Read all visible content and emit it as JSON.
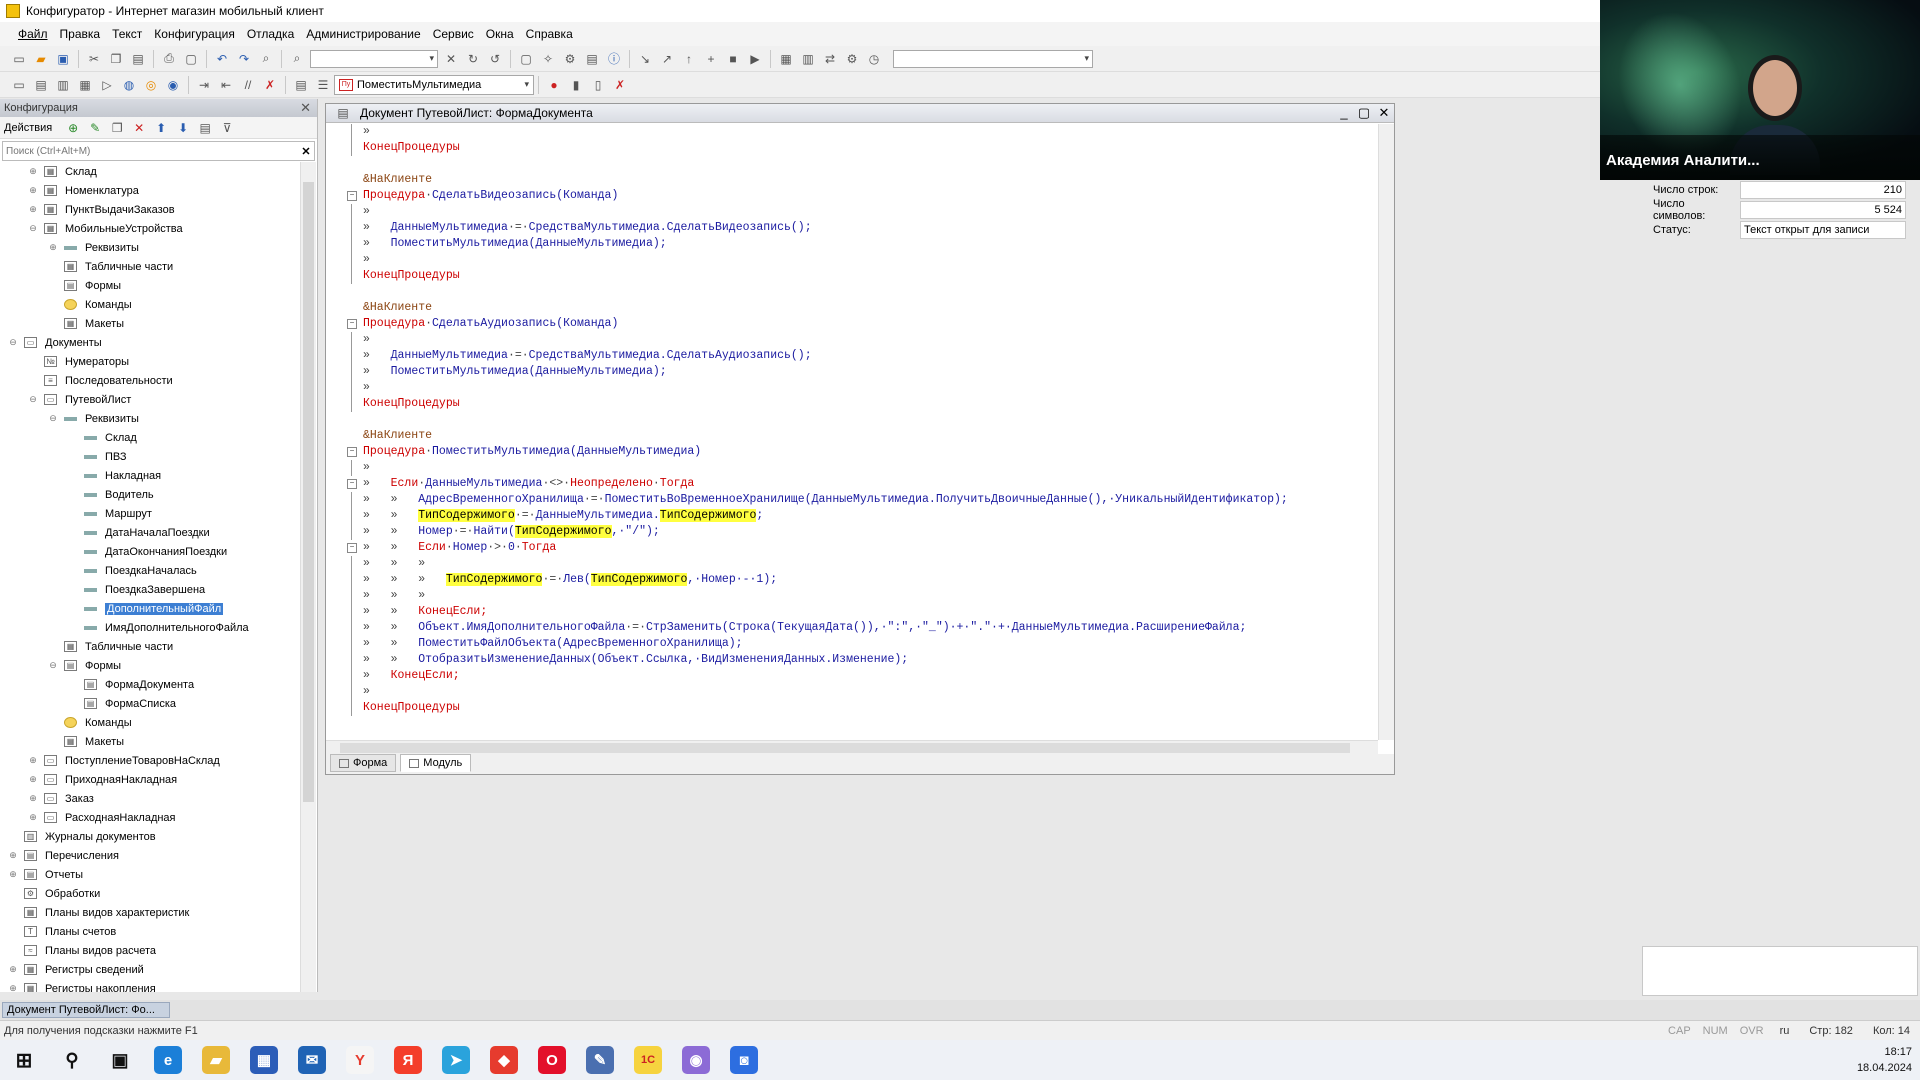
{
  "window": {
    "title": "Конфигуратор - Интернет магазин мобильный клиент"
  },
  "menu": [
    "Файл",
    "Правка",
    "Текст",
    "Конфигурация",
    "Отладка",
    "Администрирование",
    "Сервис",
    "Окна",
    "Справка"
  ],
  "toolbar2": {
    "procedure_select": "ПоместитьМультимедиа",
    "procedure_icon": "Пу"
  },
  "config_panel": {
    "title": "Конфигурация",
    "actions_label": "Действия",
    "search_placeholder": "Поиск (Ctrl+Alt+M)",
    "tree": [
      {
        "label": "Склад",
        "level": 1,
        "exp": "+",
        "icon": "table"
      },
      {
        "label": "Номенклатура",
        "level": 1,
        "exp": "+",
        "icon": "table"
      },
      {
        "label": "ПунктВыдачиЗаказов",
        "level": 1,
        "exp": "+",
        "icon": "table"
      },
      {
        "label": "МобильныеУстройства",
        "level": 1,
        "exp": "−",
        "icon": "table"
      },
      {
        "label": "Реквизиты",
        "level": 2,
        "exp": "+",
        "icon": "attr"
      },
      {
        "label": "Табличные части",
        "level": 2,
        "exp": "",
        "icon": "table"
      },
      {
        "label": "Формы",
        "level": 2,
        "exp": "",
        "icon": "form"
      },
      {
        "label": "Команды",
        "level": 2,
        "exp": "",
        "icon": "cmd"
      },
      {
        "label": "Макеты",
        "level": 2,
        "exp": "",
        "icon": "table"
      },
      {
        "label": "Документы",
        "level": 0,
        "exp": "−",
        "icon": "doc"
      },
      {
        "label": "Нумераторы",
        "level": 1,
        "exp": "",
        "icon": "num"
      },
      {
        "label": "Последовательности",
        "level": 1,
        "exp": "",
        "icon": "seq"
      },
      {
        "label": "ПутевойЛист",
        "level": 1,
        "exp": "−",
        "icon": "doc"
      },
      {
        "label": "Реквизиты",
        "level": 2,
        "exp": "−",
        "icon": "attr"
      },
      {
        "label": "Склад",
        "level": 3,
        "exp": "",
        "icon": "attr"
      },
      {
        "label": "ПВЗ",
        "level": 3,
        "exp": "",
        "icon": "attr"
      },
      {
        "label": "Накладная",
        "level": 3,
        "exp": "",
        "icon": "attr"
      },
      {
        "label": "Водитель",
        "level": 3,
        "exp": "",
        "icon": "attr"
      },
      {
        "label": "Маршрут",
        "level": 3,
        "exp": "",
        "icon": "attr"
      },
      {
        "label": "ДатаНачалаПоездки",
        "level": 3,
        "exp": "",
        "icon": "attr"
      },
      {
        "label": "ДатаОкончанияПоездки",
        "level": 3,
        "exp": "",
        "icon": "attr"
      },
      {
        "label": "ПоездкаНачалась",
        "level": 3,
        "exp": "",
        "icon": "attr"
      },
      {
        "label": "ПоездкаЗавершена",
        "level": 3,
        "exp": "",
        "icon": "attr"
      },
      {
        "label": "ДополнительныйФайл",
        "level": 3,
        "exp": "",
        "icon": "attr",
        "selected": true
      },
      {
        "label": "ИмяДополнительногоФайла",
        "level": 3,
        "exp": "",
        "icon": "attr"
      },
      {
        "label": "Табличные части",
        "level": 2,
        "exp": "",
        "icon": "table"
      },
      {
        "label": "Формы",
        "level": 2,
        "exp": "−",
        "icon": "form"
      },
      {
        "label": "ФормаДокумента",
        "level": 3,
        "exp": "",
        "icon": "form"
      },
      {
        "label": "ФормаСписка",
        "level": 3,
        "exp": "",
        "icon": "form"
      },
      {
        "label": "Команды",
        "level": 2,
        "exp": "",
        "icon": "cmd"
      },
      {
        "label": "Макеты",
        "level": 2,
        "exp": "",
        "icon": "table"
      },
      {
        "label": "ПоступлениеТоваровНаСклад",
        "level": 1,
        "exp": "+",
        "icon": "doc"
      },
      {
        "label": "ПриходнаяНакладная",
        "level": 1,
        "exp": "+",
        "icon": "doc"
      },
      {
        "label": "Заказ",
        "level": 1,
        "exp": "+",
        "icon": "doc"
      },
      {
        "label": "РасходнаяНакладная",
        "level": 1,
        "exp": "+",
        "icon": "doc"
      },
      {
        "label": "Журналы документов",
        "level": 0,
        "exp": "",
        "icon": "journal"
      },
      {
        "label": "Перечисления",
        "level": 0,
        "exp": "+",
        "icon": "enum"
      },
      {
        "label": "Отчеты",
        "level": 0,
        "exp": "+",
        "icon": "report"
      },
      {
        "label": "Обработки",
        "level": 0,
        "exp": "",
        "icon": "proc"
      },
      {
        "label": "Планы видов характеристик",
        "level": 0,
        "exp": "",
        "icon": "table"
      },
      {
        "label": "Планы счетов",
        "level": 0,
        "exp": "",
        "icon": "acc"
      },
      {
        "label": "Планы видов расчета",
        "level": 0,
        "exp": "",
        "icon": "calc"
      },
      {
        "label": "Регистры сведений",
        "level": 0,
        "exp": "+",
        "icon": "table"
      },
      {
        "label": "Регистры накопления",
        "level": 0,
        "exp": "+",
        "icon": "table"
      }
    ]
  },
  "document_window": {
    "title": "Документ ПутевойЛист: ФормаДокумента",
    "tabs": [
      "Форма",
      "Модуль"
    ],
    "code": [
      {
        "g": "v",
        "t": [
          [
            "arr",
            "»"
          ]
        ]
      },
      {
        "g": "v",
        "t": [
          [
            "kw",
            "КонецПроцедуры"
          ]
        ]
      },
      {
        "g": "",
        "t": [
          [
            "arr",
            ""
          ]
        ]
      },
      {
        "g": "",
        "t": [
          [
            "dir",
            "&НаКлиенте"
          ]
        ]
      },
      {
        "g": "f",
        "t": [
          [
            "kw",
            "Процедура"
          ],
          [
            "arr",
            "·"
          ],
          [
            "id",
            "СделатьВидеозапись(Команда)"
          ]
        ]
      },
      {
        "g": "v",
        "t": [
          [
            "arr",
            "»"
          ]
        ]
      },
      {
        "g": "v",
        "t": [
          [
            "arr",
            "»   "
          ],
          [
            "id",
            "ДанныеМультимедиа"
          ],
          [
            "arr",
            "·=·"
          ],
          [
            "id",
            "СредстваМультимедиа.СделатьВидеозапись();"
          ]
        ]
      },
      {
        "g": "v",
        "t": [
          [
            "arr",
            "»   "
          ],
          [
            "id",
            "ПоместитьМультимедиа(ДанныеМультимедиа);"
          ]
        ]
      },
      {
        "g": "v",
        "t": [
          [
            "arr",
            "»"
          ]
        ]
      },
      {
        "g": "v",
        "t": [
          [
            "kw",
            "КонецПроцедуры"
          ]
        ]
      },
      {
        "g": "",
        "t": [
          [
            "arr",
            ""
          ]
        ]
      },
      {
        "g": "",
        "t": [
          [
            "dir",
            "&НаКлиенте"
          ]
        ]
      },
      {
        "g": "f",
        "t": [
          [
            "kw",
            "Процедура"
          ],
          [
            "arr",
            "·"
          ],
          [
            "id",
            "СделатьАудиозапись(Команда)"
          ]
        ]
      },
      {
        "g": "v",
        "t": [
          [
            "arr",
            "»"
          ]
        ]
      },
      {
        "g": "v",
        "t": [
          [
            "arr",
            "»   "
          ],
          [
            "id",
            "ДанныеМультимедиа"
          ],
          [
            "arr",
            "·=·"
          ],
          [
            "id",
            "СредстваМультимедиа.СделатьАудиозапись();"
          ]
        ]
      },
      {
        "g": "v",
        "t": [
          [
            "arr",
            "»   "
          ],
          [
            "id",
            "ПоместитьМультимедиа(ДанныеМультимедиа);"
          ]
        ]
      },
      {
        "g": "v",
        "t": [
          [
            "arr",
            "»"
          ]
        ]
      },
      {
        "g": "v",
        "t": [
          [
            "kw",
            "КонецПроцедуры"
          ]
        ]
      },
      {
        "g": "",
        "t": [
          [
            "arr",
            ""
          ]
        ]
      },
      {
        "g": "",
        "t": [
          [
            "dir",
            "&НаКлиенте"
          ]
        ]
      },
      {
        "g": "f",
        "t": [
          [
            "kw",
            "Процедура"
          ],
          [
            "arr",
            "·"
          ],
          [
            "id",
            "ПоместитьМультимедиа(ДанныеМультимедиа)"
          ]
        ]
      },
      {
        "g": "v",
        "t": [
          [
            "arr",
            "»"
          ]
        ]
      },
      {
        "g": "f",
        "t": [
          [
            "arr",
            "»   "
          ],
          [
            "kw",
            "Если"
          ],
          [
            "arr",
            "·"
          ],
          [
            "id",
            "ДанныеМультимедиа"
          ],
          [
            "arr",
            "·<>·"
          ],
          [
            "kw",
            "Неопределено"
          ],
          [
            "arr",
            "·"
          ],
          [
            "kw",
            "Тогда"
          ]
        ]
      },
      {
        "g": "v",
        "t": [
          [
            "arr",
            "»   »   "
          ],
          [
            "id",
            "АдресВременногоХранилища"
          ],
          [
            "arr",
            "·=·"
          ],
          [
            "id",
            "ПоместитьВоВременноеХранилище(ДанныеМультимедиа.ПолучитьДвоичныеДанные(),·УникальныйИдентификатор);"
          ]
        ]
      },
      {
        "g": "v",
        "t": [
          [
            "arr",
            "»   »   "
          ],
          [
            "hl",
            "ТипСодержимого"
          ],
          [
            "arr",
            "·=·"
          ],
          [
            "id",
            "ДанныеМультимедиа."
          ],
          [
            "hl",
            "ТипСодержимого"
          ],
          [
            "id",
            ";"
          ]
        ]
      },
      {
        "g": "v",
        "t": [
          [
            "arr",
            "»   »   "
          ],
          [
            "id",
            "Номер"
          ],
          [
            "arr",
            "·=·"
          ],
          [
            "id",
            "Найти("
          ],
          [
            "hl",
            "ТипСодержимого"
          ],
          [
            "id",
            ",·\"/\");"
          ]
        ]
      },
      {
        "g": "f",
        "t": [
          [
            "arr",
            "»   »   "
          ],
          [
            "kw",
            "Если"
          ],
          [
            "arr",
            "·"
          ],
          [
            "id",
            "Номер"
          ],
          [
            "arr",
            "·>·"
          ],
          [
            "id",
            "0"
          ],
          [
            "arr",
            "·"
          ],
          [
            "kw",
            "Тогда"
          ]
        ]
      },
      {
        "g": "v",
        "t": [
          [
            "arr",
            "»   »   »"
          ]
        ]
      },
      {
        "g": "v",
        "t": [
          [
            "arr",
            "»   »   »   "
          ],
          [
            "hl",
            "ТипСодержимого"
          ],
          [
            "arr",
            "·=·"
          ],
          [
            "id",
            "Лев("
          ],
          [
            "hl",
            "ТипСодержимого"
          ],
          [
            "id",
            ",·Номер·-·1);"
          ]
        ]
      },
      {
        "g": "v",
        "t": [
          [
            "arr",
            "»   »   »"
          ]
        ]
      },
      {
        "g": "v",
        "t": [
          [
            "arr",
            "»   »   "
          ],
          [
            "kw",
            "КонецЕсли;"
          ]
        ]
      },
      {
        "g": "v",
        "t": [
          [
            "arr",
            "»   »   "
          ],
          [
            "id",
            "Объект.ИмяДополнительногоФайла"
          ],
          [
            "arr",
            "·=·"
          ],
          [
            "id",
            "СтрЗаменить(Строка(ТекущаяДата()),·\":\",·\"_\")·+·\".\"·+·ДанныеМультимедиа.РасширениеФайла;"
          ]
        ]
      },
      {
        "g": "v",
        "t": [
          [
            "arr",
            "»   »   "
          ],
          [
            "id",
            "ПоместитьФайлОбъекта(АдресВременногоХранилища);"
          ]
        ]
      },
      {
        "g": "v",
        "t": [
          [
            "arr",
            "»   »   "
          ],
          [
            "id",
            "ОтобразитьИзменениеДанных(Объект.Ссылка,·ВидИзмененияДанных.Изменение);"
          ]
        ]
      },
      {
        "g": "v",
        "t": [
          [
            "arr",
            "»   "
          ],
          [
            "kw",
            "КонецЕсли;"
          ]
        ]
      },
      {
        "g": "v",
        "t": [
          [
            "arr",
            "»"
          ]
        ]
      },
      {
        "g": "v",
        "t": [
          [
            "kw",
            "КонецПроцедуры"
          ]
        ]
      },
      {
        "g": "",
        "t": [
          [
            "arr",
            ""
          ]
        ]
      }
    ]
  },
  "properties": [
    {
      "key": "Число строк:",
      "value": "210",
      "num": true
    },
    {
      "key": "Число символов:",
      "value": "5 524",
      "num": true
    },
    {
      "key": "Статус:",
      "value": "Текст открыт для записи",
      "num": false
    }
  ],
  "webcam": {
    "caption": "Академия Аналити..."
  },
  "window_tab": "Документ ПутевойЛист: Фо...",
  "statusbar": {
    "hint": "Для получения подсказки нажмите F1",
    "indicators": [
      "CAP",
      "NUM",
      "OVR"
    ],
    "lang": "ru",
    "line": "Стр: 182",
    "col": "Кол: 14"
  },
  "clock": {
    "time": "18:17",
    "date": "18.04.2024"
  },
  "taskbar": [
    {
      "name": "start-icon",
      "glyph": "⊞",
      "bg": "",
      "cls": "start"
    },
    {
      "name": "search-icon",
      "glyph": "⚲",
      "bg": "",
      "cls": "plain"
    },
    {
      "name": "task-view-icon",
      "glyph": "▣",
      "bg": "",
      "cls": "plain"
    },
    {
      "name": "edge-icon",
      "glyph": "e",
      "bg": "#1b7fd8",
      "cls": ""
    },
    {
      "name": "explorer-icon",
      "glyph": "▰",
      "bg": "#e8b93a",
      "cls": ""
    },
    {
      "name": "store-icon",
      "glyph": "▦",
      "bg": "#2b5db8",
      "cls": ""
    },
    {
      "name": "mail-icon",
      "glyph": "✉",
      "bg": "#1f63b5",
      "cls": ""
    },
    {
      "name": "yandex-browser-icon",
      "glyph": "Y",
      "bg": "#f5f5f5",
      "cls": "ybr"
    },
    {
      "name": "yandex-icon",
      "glyph": "Я",
      "bg": "#f43e2a",
      "cls": ""
    },
    {
      "name": "telegram-icon",
      "glyph": "➤",
      "bg": "#2aa3dc",
      "cls": ""
    },
    {
      "name": "anydesk-icon",
      "glyph": "◆",
      "bg": "#e63b2e",
      "cls": ""
    },
    {
      "name": "opera-icon",
      "glyph": "O",
      "bg": "#e3102b",
      "cls": ""
    },
    {
      "name": "tools-icon",
      "glyph": "✎",
      "bg": "#4a6fb0",
      "cls": ""
    },
    {
      "name": "1c-icon",
      "glyph": "1С",
      "bg": "#f6d33f",
      "cls": "onec"
    },
    {
      "name": "discord-icon",
      "glyph": "◉",
      "bg": "#8c6bd6",
      "cls": ""
    },
    {
      "name": "zoom-icon",
      "glyph": "◙",
      "bg": "#2d6ee0",
      "cls": ""
    }
  ]
}
